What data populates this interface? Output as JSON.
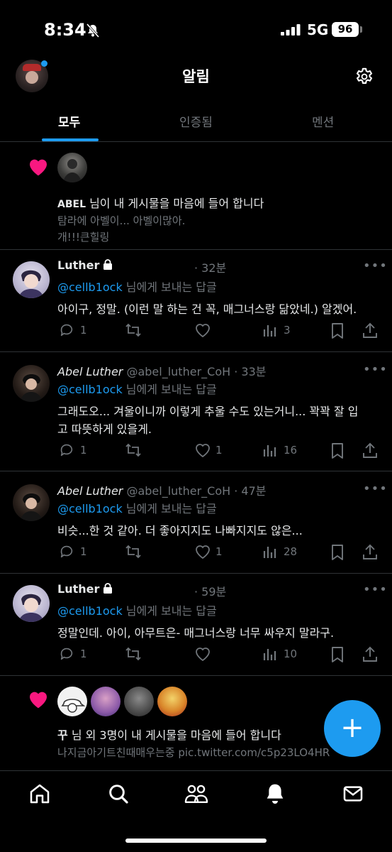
{
  "status_bar": {
    "time": "8:34",
    "network": "5G",
    "battery": "96"
  },
  "header": {
    "title": "알림"
  },
  "tabs": [
    {
      "label": "모두",
      "active": true
    },
    {
      "label": "인증됨",
      "active": false
    },
    {
      "label": "멘션",
      "active": false
    }
  ],
  "notifications": {
    "like1": {
      "user": "ABEL",
      "text": " 님이 내 게시물을 마음에 들어 합니다",
      "preview_line1": "탐라에 아벨이... 아벨이많아.",
      "preview_line2": "개!!!큰힐링"
    },
    "like2": {
      "user": "꾸",
      "text": " 님 외 3명이 내 게시물을 마음에 들어 합니다",
      "preview": "나지금아기트친때매우는중 pic.twitter.com/c5p23LO4HR"
    }
  },
  "replies": [
    {
      "name": "Luther",
      "handle": "",
      "time": "· 32분",
      "reply_to": "@cellb1ock",
      "reply_suffix": " 님에게 보내는 답글",
      "text_line1": "아이구, 정말. (이런 말 하는 건 꼭, 매그너스랑 닮았네.) 알겠어.",
      "text_line2": "",
      "replies": "1",
      "retweets": "",
      "likes": "",
      "views": "3"
    },
    {
      "name": "Abel Luther",
      "handle": "@abel_luther_CoH",
      "time": "· 33분",
      "reply_to": "@cellb1ock",
      "reply_suffix": " 님에게 보내는 답글",
      "text_line1": "그래도오... 겨울이니까 이렇게 추울 수도 있는거니... 꽉꽉 잘 입",
      "text_line2": "고 따뜻하게 있을게.",
      "replies": "1",
      "retweets": "",
      "likes": "1",
      "views": "16"
    },
    {
      "name": "Abel Luther",
      "handle": "@abel_luther_CoH",
      "time": "· 47분",
      "reply_to": "@cellb1ock",
      "reply_suffix": " 님에게 보내는 답글",
      "text_line1": "비슷...한 것 같아. 더 좋아지지도 나빠지지도 않은...",
      "text_line2": "",
      "replies": "1",
      "retweets": "",
      "likes": "1",
      "views": "28"
    },
    {
      "name": "Luther",
      "handle": "",
      "time": "· 59분",
      "reply_to": "@cellb1ock",
      "reply_suffix": " 님에게 보내는 답글",
      "text_line1": "정말인데. 아이, 아무트은- 매그너스랑 너무 싸우지 말라구.",
      "text_line2": "",
      "replies": "1",
      "retweets": "",
      "likes": "",
      "views": "10"
    }
  ],
  "colors": {
    "accent": "#1d9bf0",
    "heart": "#f91880",
    "muted": "#71767b",
    "divider": "#2f3336"
  },
  "icons": [
    "bell-slash-icon",
    "signal-icon",
    "gear-icon",
    "heart-icon",
    "reply-icon",
    "retweet-icon",
    "like-icon",
    "views-icon",
    "bookmark-icon",
    "share-icon",
    "more-icon",
    "plus-icon",
    "home-icon",
    "search-icon",
    "communities-icon",
    "notifications-icon",
    "messages-icon",
    "lock-icon"
  ]
}
